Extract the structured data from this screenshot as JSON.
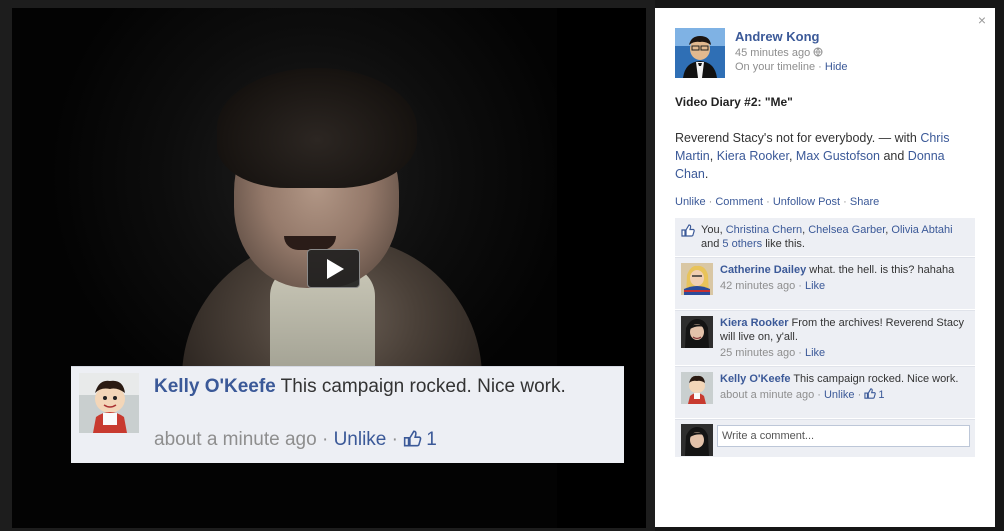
{
  "overlay": {
    "author": "Kelly O'Keefe",
    "text": " This campaign rocked. Nice work.",
    "time": "about a minute ago",
    "sep1": " · ",
    "unlike": "Unlike",
    "sep2": " · ",
    "likes": "1"
  },
  "panel": {
    "close": "×",
    "owner": {
      "name": "Andrew Kong",
      "time": "45 minutes ago",
      "timeline": "On your timeline",
      "sep": " · ",
      "hide": "Hide"
    },
    "post_title": "Video Diary #2: \"Me\"",
    "body": {
      "text": "Reverend Stacy's not for everybody. — with ",
      "tag1": "Chris Martin",
      "c1": ", ",
      "tag2": "Kiera Rooker",
      "c2": ", ",
      "tag3": "Max Gustofson",
      "and": " and ",
      "tag4": "Donna Chan",
      "end": "."
    },
    "actions": {
      "unlike": "Unlike",
      "comment": "Comment",
      "unfollow": "Unfollow Post",
      "share": "Share",
      "sep": " · "
    },
    "likes": {
      "you": "You, ",
      "p1": "Christina Chern",
      "c1": ", ",
      "p2": "Chelsea Garber",
      "c2": ", ",
      "p3": "Olivia Abtahi",
      "and": " and ",
      "others": "5 others",
      "tail": " like this."
    },
    "comments": [
      {
        "name": "Catherine Dailey",
        "text": " what. the hell. is this? hahaha",
        "time": "42 minutes ago",
        "sep": " · ",
        "action": "Like",
        "likes": ""
      },
      {
        "name": "Kiera Rooker",
        "text": " From the archives! Reverend Stacy will live on, y'all.",
        "time": "25 minutes ago",
        "sep": " · ",
        "action": "Like",
        "likes": ""
      },
      {
        "name": "Kelly O'Keefe",
        "text": " This campaign rocked. Nice work.",
        "time": "about a minute ago",
        "sep": " · ",
        "action": "Unlike",
        "likes": "1"
      }
    ],
    "write_placeholder": "Write a comment..."
  },
  "colors": {
    "link": "#3b5998",
    "ufi_bg": "#edeff4",
    "meta": "#8e8e8e"
  },
  "icons": [
    "play-icon",
    "close-icon",
    "globe-icon",
    "thumbs-up-icon"
  ]
}
